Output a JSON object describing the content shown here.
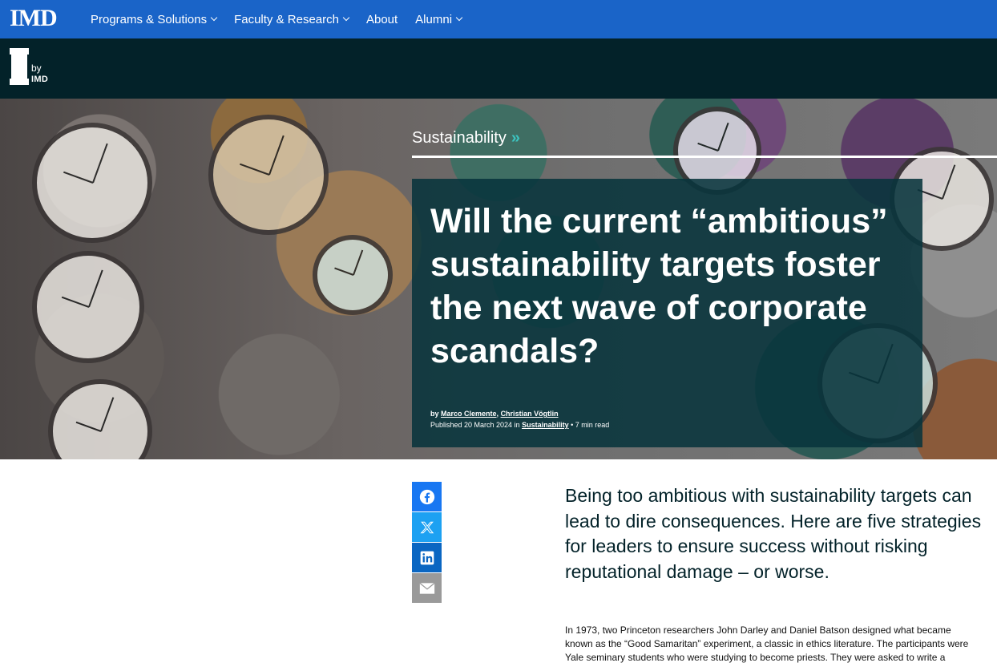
{
  "topnav": {
    "logo": "IMD",
    "items": [
      {
        "label": "Programs & Solutions",
        "dropdown": true
      },
      {
        "label": "Faculty & Research",
        "dropdown": true
      },
      {
        "label": "About",
        "dropdown": false
      },
      {
        "label": "Alumni",
        "dropdown": true
      }
    ]
  },
  "brand": {
    "letter": "I",
    "by": "by",
    "imd": "IMD"
  },
  "hero": {
    "category": "Sustainability",
    "category_arrows": "»",
    "title": "Will the current “ambitious” sustainability targets foster the next wave of corporate scandals?",
    "byline_prefix": "by ",
    "author1": "Marco Clemente",
    "author_sep": ", ",
    "author2": "Christian Vögtlin",
    "published_prefix": "Published 20 March 2024 in ",
    "published_category": "Sustainability",
    "read_time": " • 7 min read"
  },
  "share": {
    "icons": [
      "facebook-icon",
      "x-twitter-icon",
      "linkedin-icon",
      "email-icon"
    ]
  },
  "article": {
    "lead": "Being too ambitious with sustainability targets can lead to dire consequences. Here are five strategies for leaders to ensure success without risking reputational damage – or worse.",
    "body": "In 1973, two Princeton researchers John Darley and Daniel Batson designed what became known as the “Good Samaritan” experiment, a classic in ethics literature. The participants were Yale seminary students who were studying to become priests. They were asked to write a"
  },
  "colors": {
    "nav": "#1a64c8",
    "brandbar": "#032229",
    "accent": "#3cc4c0",
    "titlebox": "#08343c"
  }
}
